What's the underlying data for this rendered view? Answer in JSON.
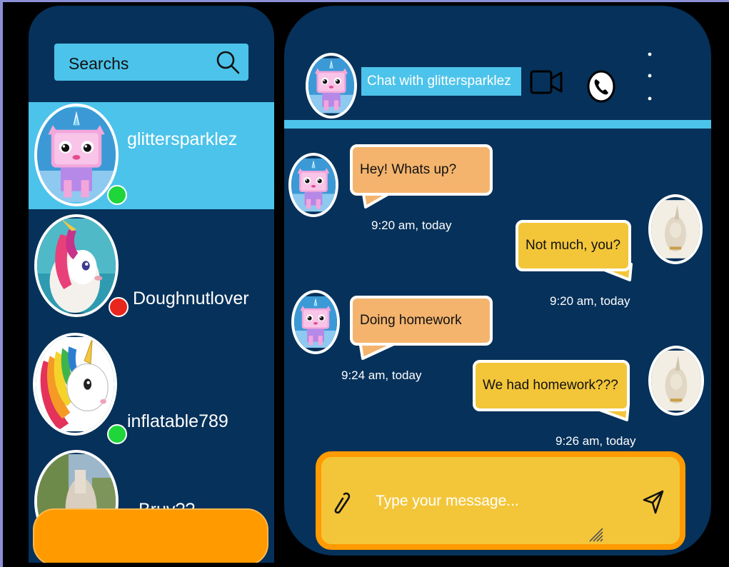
{
  "colors": {
    "panel_background": "#06315a",
    "accent_cyan": "#4cc3ea",
    "accent_orange": "#ff9a00",
    "incoming_bubble": "#f4b46e",
    "outgoing_bubble": "#f3c63a",
    "status_online": "#1fd63a",
    "status_busy": "#e8261e"
  },
  "sidebar": {
    "search": {
      "text": "Searchs",
      "icon": "search-icon"
    },
    "contacts": [
      {
        "name": "glittersparklez",
        "status": "online",
        "active": true,
        "avatar": "unikitty-avatar"
      },
      {
        "name": "Doughnutlover",
        "status": "busy",
        "active": false,
        "avatar": "unicorn-float-avatar"
      },
      {
        "name": "inflatable789",
        "status": "online",
        "active": false,
        "avatar": "rainbow-unicorn-avatar"
      },
      {
        "name": "Bruv??",
        "status": "none",
        "active": false,
        "avatar": "garden-statue-avatar"
      }
    ]
  },
  "chat": {
    "title": "Chat with glittersparklez",
    "icons": [
      "video-camera-icon",
      "phone-icon",
      "more-options-icon"
    ],
    "messages": [
      {
        "direction": "incoming",
        "text": "Hey! Whats up?",
        "time": "9:20 am, today"
      },
      {
        "direction": "outgoing",
        "text": "Not much, you?",
        "time": "9:20 am, today"
      },
      {
        "direction": "incoming",
        "text": "Doing homework",
        "time": "9:24 am, today"
      },
      {
        "direction": "outgoing",
        "text": "We had homework???",
        "time": "9:26 am, today"
      }
    ],
    "composer": {
      "placeholder": "Type your message...",
      "attach_icon": "paperclip-icon",
      "send_icon": "send-icon"
    }
  }
}
